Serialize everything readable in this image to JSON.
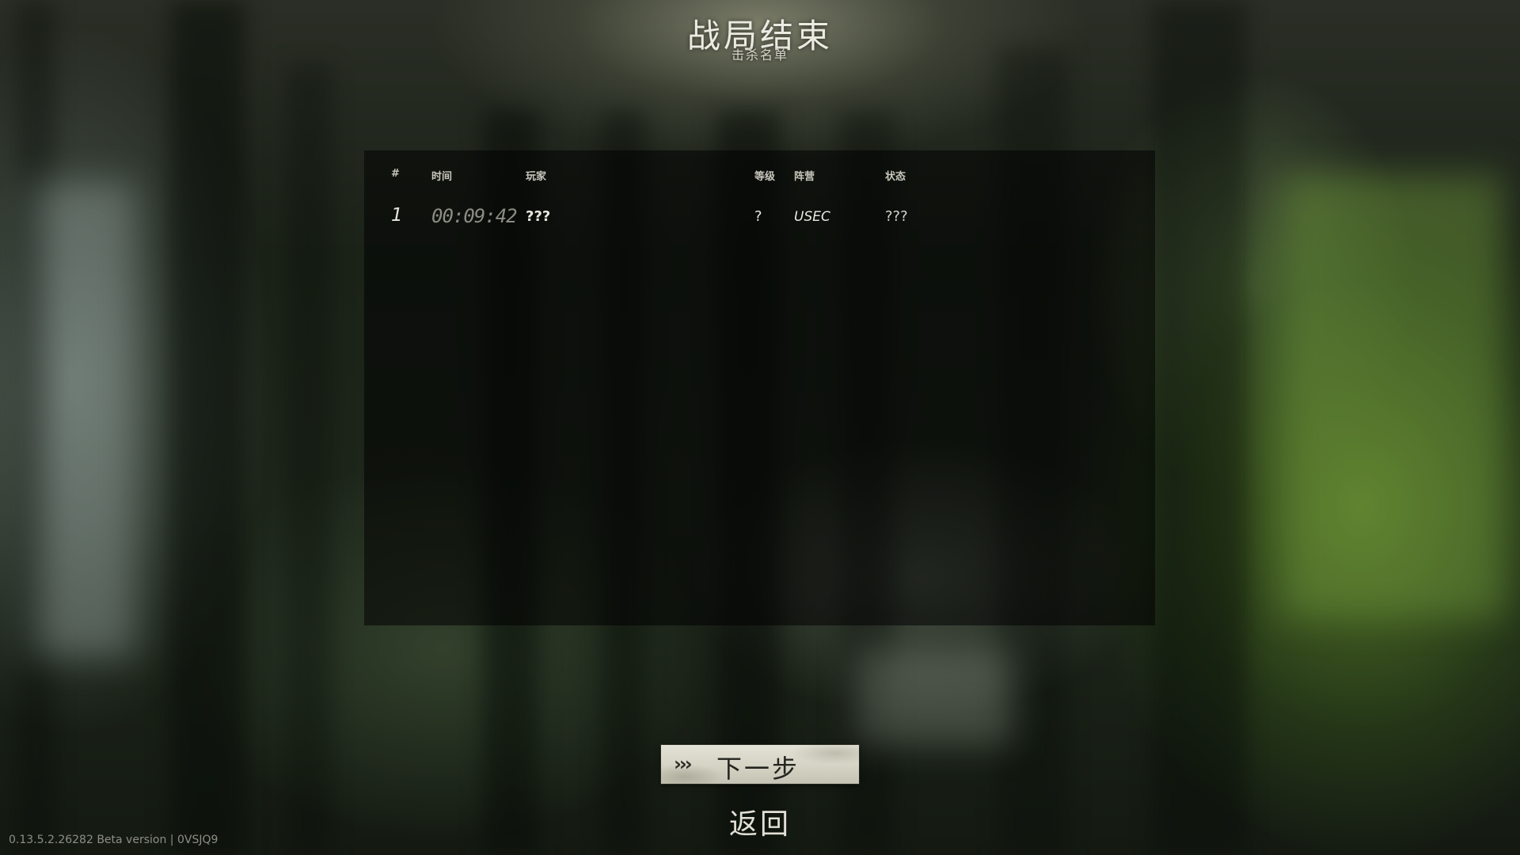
{
  "header": {
    "title": "战局结束",
    "subtitle": "击杀名单"
  },
  "table": {
    "columns": {
      "num": "#",
      "time": "时间",
      "player": "玩家",
      "level": "等级",
      "side": "阵营",
      "status": "状态"
    },
    "rows": [
      {
        "num": "1",
        "time": "00:09:42",
        "player": "???",
        "level": "?",
        "side": "USEC",
        "status": "???"
      }
    ]
  },
  "footer": {
    "next_arrows": "›››",
    "next_label": "下一步",
    "back_label": "返回",
    "version": "0.13.5.2.26282 Beta version | 0VSJQ9"
  },
  "colors": {
    "title_text": "#ecebe2",
    "panel_bg": "rgba(0,0,0,0.52)",
    "button_bg": "#d4d3c4",
    "time_text": "#8d8c84"
  },
  "icons": {
    "next_arrows": "triple-chevron-right-icon"
  }
}
